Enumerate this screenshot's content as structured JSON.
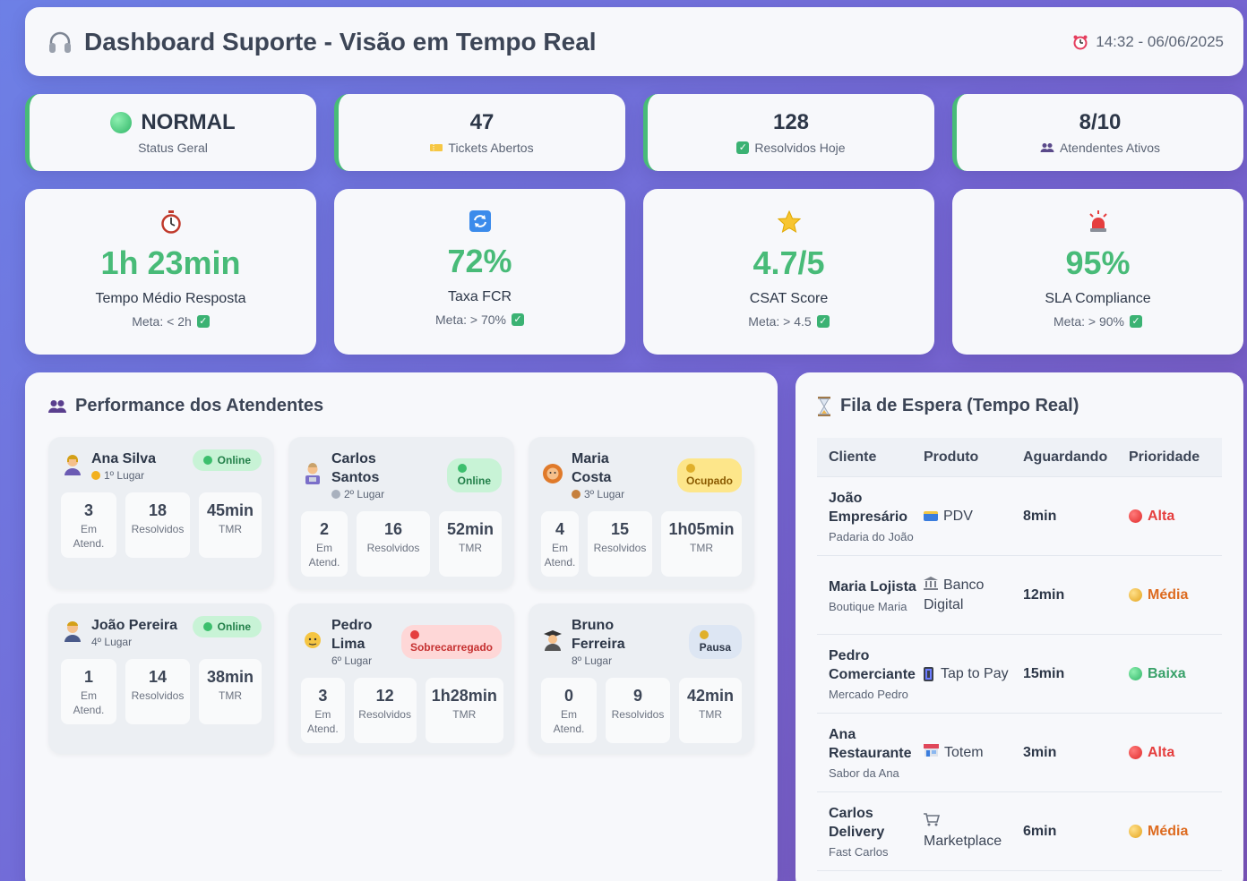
{
  "header": {
    "title": "Dashboard Suporte - Visão em Tempo Real",
    "datetime": "14:32 - 06/06/2025",
    "icons": {
      "title": "headphones-icon",
      "time": "alarm-clock-icon"
    }
  },
  "status_cards": [
    {
      "value": "NORMAL",
      "label": "Status Geral",
      "icon": "green-circle-icon"
    },
    {
      "value": "47",
      "label": "Tickets Abertos",
      "icon": "ticket-icon"
    },
    {
      "value": "128",
      "label": "Resolvidos Hoje",
      "icon": "check-icon"
    },
    {
      "value": "8/10",
      "label": "Atendentes Ativos",
      "icon": "people-icon"
    }
  ],
  "kpis": [
    {
      "value": "1h 23min",
      "label": "Tempo Médio Resposta",
      "meta": "Meta: < 2h",
      "icon": "stopwatch-icon"
    },
    {
      "value": "72%",
      "label": "Taxa FCR",
      "meta": "Meta: > 70%",
      "icon": "refresh-icon"
    },
    {
      "value": "4.7/5",
      "label": "CSAT Score",
      "meta": "Meta: > 4.5",
      "icon": "star-icon"
    },
    {
      "value": "95%",
      "label": "SLA Compliance",
      "meta": "Meta: > 90%",
      "icon": "siren-icon"
    }
  ],
  "performance": {
    "title": "Performance dos Atendentes",
    "agents": [
      {
        "name": "Ana Silva",
        "rank": "1º Lugar",
        "status": "Online",
        "em_atend": "3",
        "resolvidos": "18",
        "tmr": "45min"
      },
      {
        "name": "Carlos Santos",
        "rank": "2º Lugar",
        "status": "Online",
        "em_atend": "2",
        "resolvidos": "16",
        "tmr": "52min"
      },
      {
        "name": "Maria Costa",
        "rank": "3º Lugar",
        "status": "Ocupado",
        "em_atend": "4",
        "resolvidos": "15",
        "tmr": "1h05min"
      },
      {
        "name": "João Pereira",
        "rank": "4º Lugar",
        "status": "Online",
        "em_atend": "1",
        "resolvidos": "14",
        "tmr": "38min"
      },
      {
        "name": "Pedro Lima",
        "rank": "6º Lugar",
        "status": "Sobrecarregado",
        "em_atend": "3",
        "resolvidos": "12",
        "tmr": "1h28min"
      },
      {
        "name": "Bruno Ferreira",
        "rank": "8º Lugar",
        "status": "Pausa",
        "em_atend": "0",
        "resolvidos": "9",
        "tmr": "42min"
      }
    ],
    "labels": {
      "em_atend": "Em Atend.",
      "resolvidos": "Resolvidos",
      "tmr": "TMR"
    }
  },
  "queue": {
    "title": "Fila de Espera (Tempo Real)",
    "columns": [
      "Cliente",
      "Produto",
      "Aguardando",
      "Prioridade"
    ],
    "rows": [
      {
        "client": "João Empresário",
        "company": "Padaria do João",
        "product": "PDV",
        "product_icon": "credit-card-icon",
        "waiting": "8min",
        "priority": "Alta",
        "priority_color": "#e53e3e"
      },
      {
        "client": "Maria Lojista",
        "company": "Boutique Maria",
        "product": "Banco Digital",
        "product_icon": "bank-icon",
        "waiting": "12min",
        "priority": "Média",
        "priority_color": "#dd6b20"
      },
      {
        "client": "Pedro Comerciante",
        "company": "Mercado Pedro",
        "product": "Tap to Pay",
        "product_icon": "phone-icon",
        "waiting": "15min",
        "priority": "Baixa",
        "priority_color": "#38a169"
      },
      {
        "client": "Ana Restaurante",
        "company": "Sabor da Ana",
        "product": "Totem",
        "product_icon": "store-icon",
        "waiting": "3min",
        "priority": "Alta",
        "priority_color": "#e53e3e"
      },
      {
        "client": "Carlos Delivery",
        "company": "Fast Carlos",
        "product": "Marketplace",
        "product_icon": "cart-icon",
        "waiting": "6min",
        "priority": "Média",
        "priority_color": "#dd6b20"
      }
    ]
  },
  "colors": {
    "accent_green": "#48bb78",
    "alta": "#e53e3e",
    "media": "#dd6b20",
    "baixa": "#38a169"
  }
}
